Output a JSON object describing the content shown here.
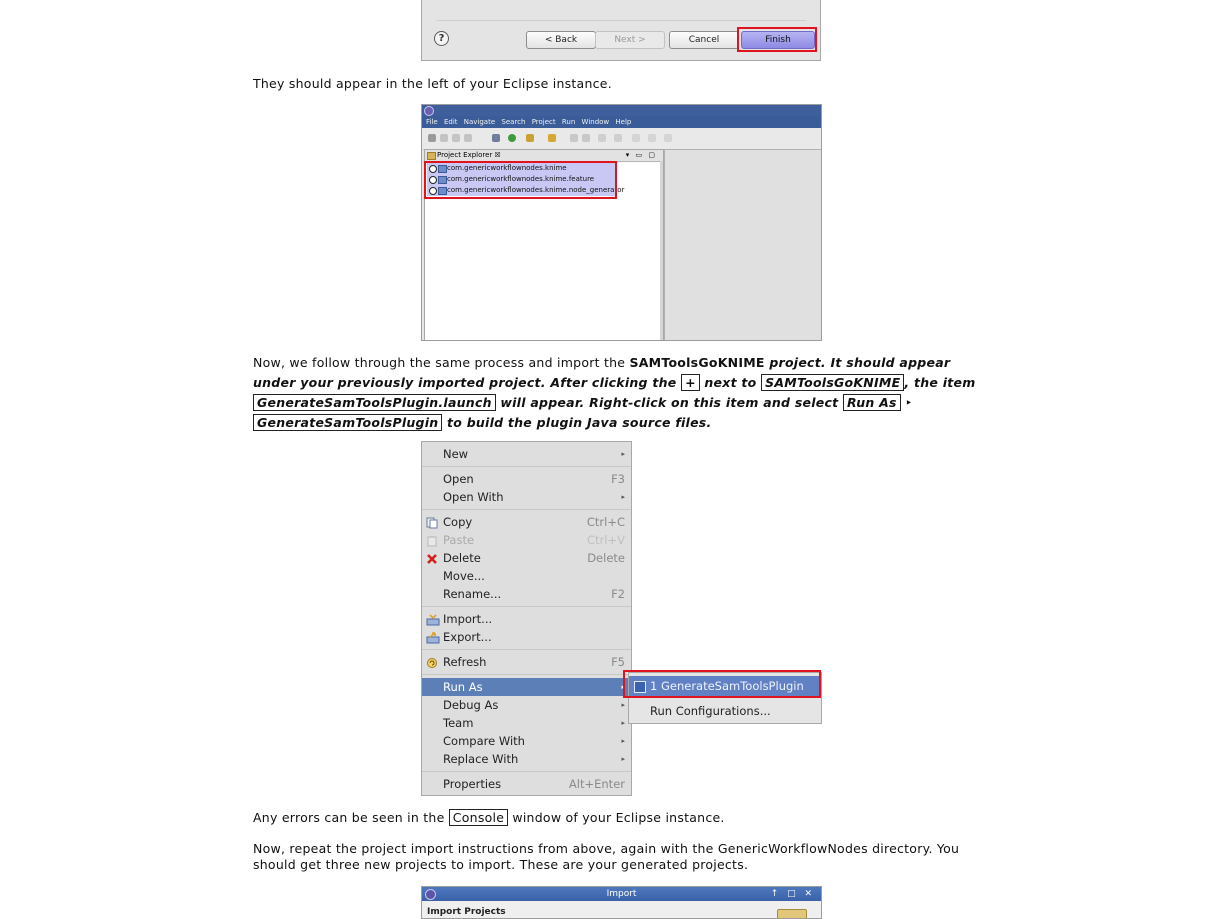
{
  "wizard": {
    "help_glyph": "?",
    "back_label": "< Back",
    "next_label": "Next >",
    "cancel_label": "Cancel",
    "finish_label": "Finish"
  },
  "text1": "They should appear in the left of your Eclipse instance.",
  "eclipse_explorer": {
    "menu": [
      "File",
      "Edit",
      "Navigate",
      "Search",
      "Project",
      "Run",
      "Window",
      "Help"
    ],
    "view_tab": "Project Explorer ☒",
    "projects": [
      "com.genericworkflownodes.knime",
      "com.genericworkflownodes.knime.feature",
      "com.genericworkflownodes.knime.node_generator"
    ]
  },
  "para2": {
    "p1": "Now, we follow through the same process and import the ",
    "b1": "SAMToolsGoKNIME",
    "p2": " project. It should appear under your previously imported project. After clicking the ",
    "c1": "+",
    "p3": " next to ",
    "c2": "SAMToolsGoKNIME",
    "p4": ", the item ",
    "c3": "GenerateSamToolsPlugin.launch",
    "p5": " will appear. Right-click on this item and select ",
    "c4": "Run As",
    "arrow": "‣",
    "c5": "GenerateSamToolsPlugin",
    "p6": " to build the plugin Java source files."
  },
  "context_menu": {
    "new": {
      "label": "New",
      "arrow": "▸"
    },
    "open": {
      "label": "Open",
      "shortcut": "F3"
    },
    "open_with": {
      "label": "Open With",
      "arrow": "▸"
    },
    "copy": {
      "label": "Copy",
      "shortcut": "Ctrl+C"
    },
    "paste": {
      "label": "Paste",
      "shortcut": "Ctrl+V"
    },
    "delete": {
      "label": "Delete",
      "shortcut": "Delete"
    },
    "move": {
      "label": "Move..."
    },
    "rename": {
      "label": "Rename...",
      "shortcut": "F2"
    },
    "import": {
      "label": "Import..."
    },
    "export": {
      "label": "Export..."
    },
    "refresh": {
      "label": "Refresh",
      "shortcut": "F5"
    },
    "run_as": {
      "label": "Run As",
      "arrow": "▸"
    },
    "debug_as": {
      "label": "Debug As",
      "arrow": "▸"
    },
    "team": {
      "label": "Team",
      "arrow": "▸"
    },
    "compare_with": {
      "label": "Compare With",
      "arrow": "▸"
    },
    "replace_with": {
      "label": "Replace With",
      "arrow": "▸"
    },
    "properties": {
      "label": "Properties",
      "shortcut": "Alt+Enter"
    }
  },
  "submenu": {
    "item1": "1 GenerateSamToolsPlugin",
    "item2": "Run Configurations..."
  },
  "para3": {
    "p1": "Any errors can be seen in the ",
    "c1": "Console",
    "p2": " window of your Eclipse instance."
  },
  "para4": "Now, repeat the project import instructions from above, again with the GenericWorkflowNodes directory. You should get three new projects to import. These are your generated projects.",
  "import_dialog": {
    "title": "Import",
    "window_controls": "↑ □ ✕",
    "header": "Import Projects"
  },
  "colors": {
    "highlight_red": "#e0141e",
    "menu_highlight": "#5d7fb8",
    "selection_purple": "#c9c8f4"
  }
}
